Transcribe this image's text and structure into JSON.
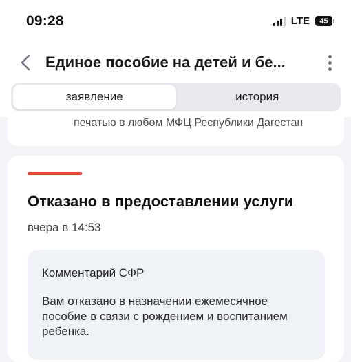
{
  "status_bar": {
    "time": "09:28",
    "network": "LTE",
    "battery": "45"
  },
  "header": {
    "title": "Единое пособие на детей и бе...",
    "back_icon": "chevron-left-icon",
    "more_icon": "vertical-dots-icon"
  },
  "tabs": [
    {
      "label": "заявление",
      "active": true
    },
    {
      "label": "история",
      "active": false
    }
  ],
  "previous_card": {
    "text": "печатью в любом МФЦ Республики Дагестан"
  },
  "status_card": {
    "accent_color": "#e04a3b",
    "title": "Отказано в предоставлении услуги",
    "date": "вчера в 14:53",
    "comment": {
      "title": "Комментарий СФР",
      "text": "Вам отказано в назначении ежемесячное пособие в связи с рождением и воспитанием ребенка."
    }
  }
}
